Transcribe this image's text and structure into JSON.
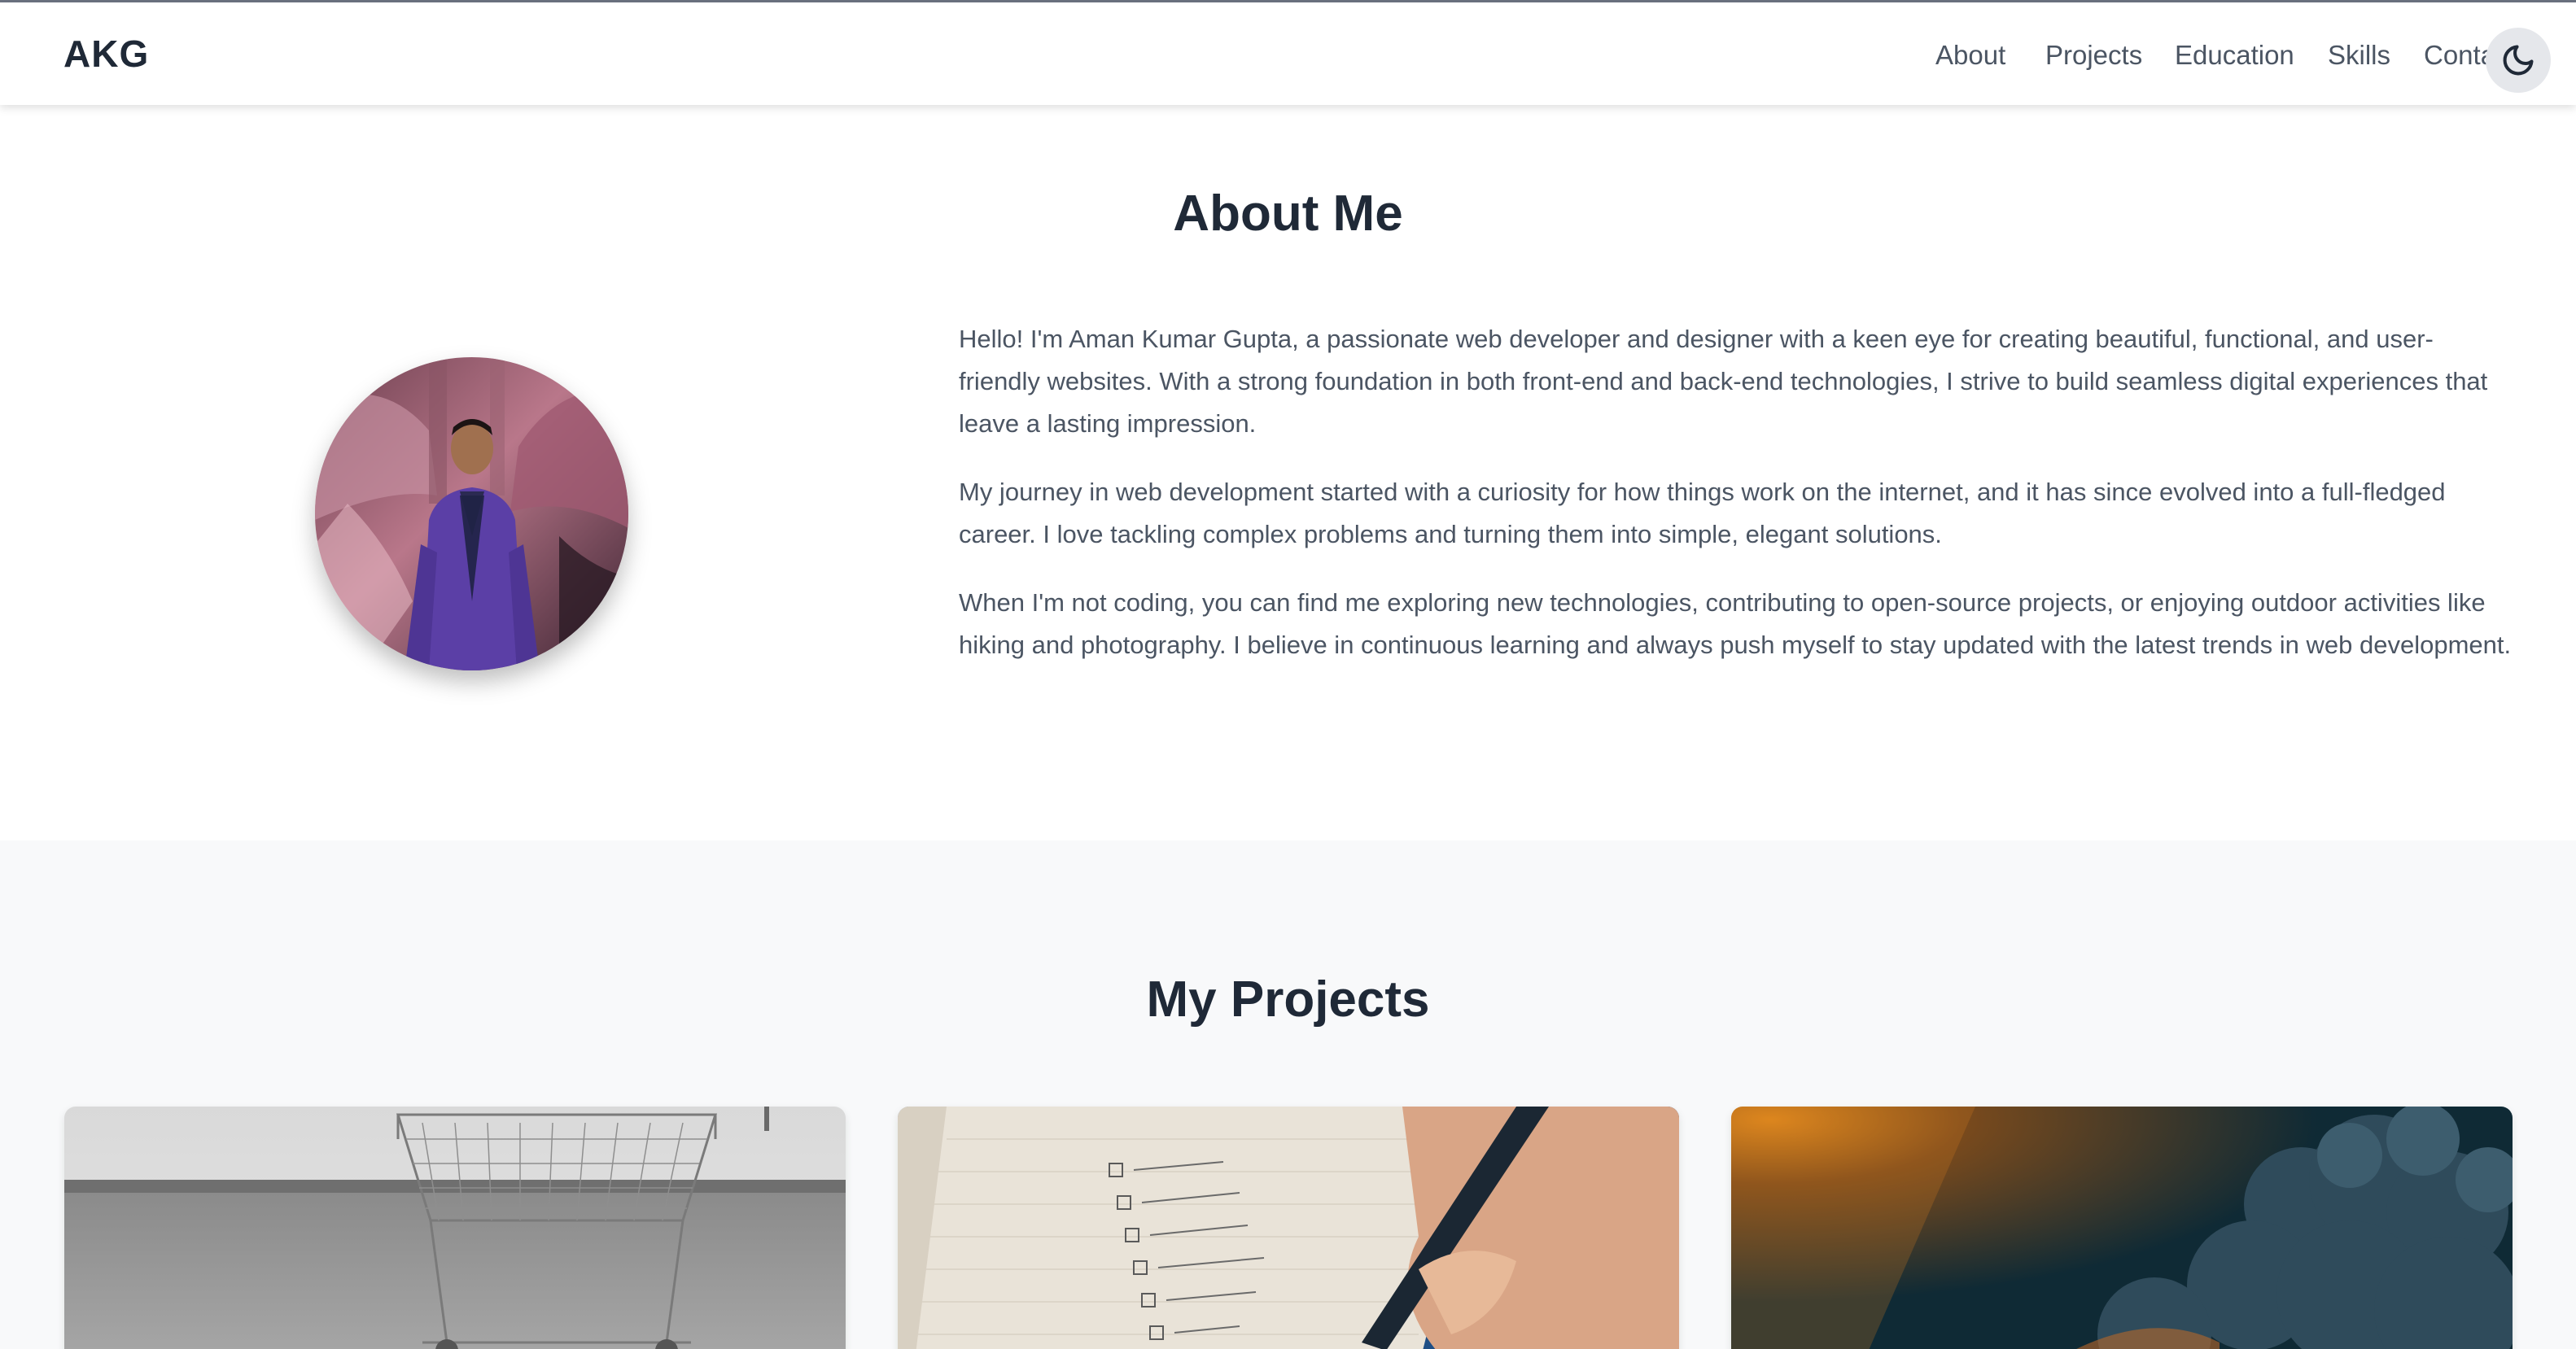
{
  "brand": "AKG",
  "nav": {
    "items": [
      {
        "label": "About"
      },
      {
        "label": "Projects"
      },
      {
        "label": "Education"
      },
      {
        "label": "Skills"
      },
      {
        "label": "Contact"
      }
    ],
    "theme_toggle_icon": "moon-icon"
  },
  "about": {
    "title": "About Me",
    "paragraphs": [
      "Hello! I'm Aman Kumar Gupta, a passionate web developer and designer with a keen eye for creating beautiful, functional, and user-friendly websites. With a strong foundation in both front-end and back-end technologies, I strive to build seamless digital experiences that leave a lasting impression.",
      "My journey in web development started with a curiosity for how things work on the internet, and it has since evolved into a full-fledged career. I love tackling complex problems and turning them into simple, elegant solutions.",
      "When I'm not coding, you can find me exploring new technologies, contributing to open-source projects, or enjoying outdoor activities like hiking and photography. I believe in continuous learning and always push myself to stay updated with the latest trends in web development."
    ]
  },
  "projects": {
    "title": "My Projects"
  },
  "colors": {
    "text_dark": "#1f2937",
    "text_body": "#4b5563",
    "section_alt_bg": "#f8f9fa"
  }
}
